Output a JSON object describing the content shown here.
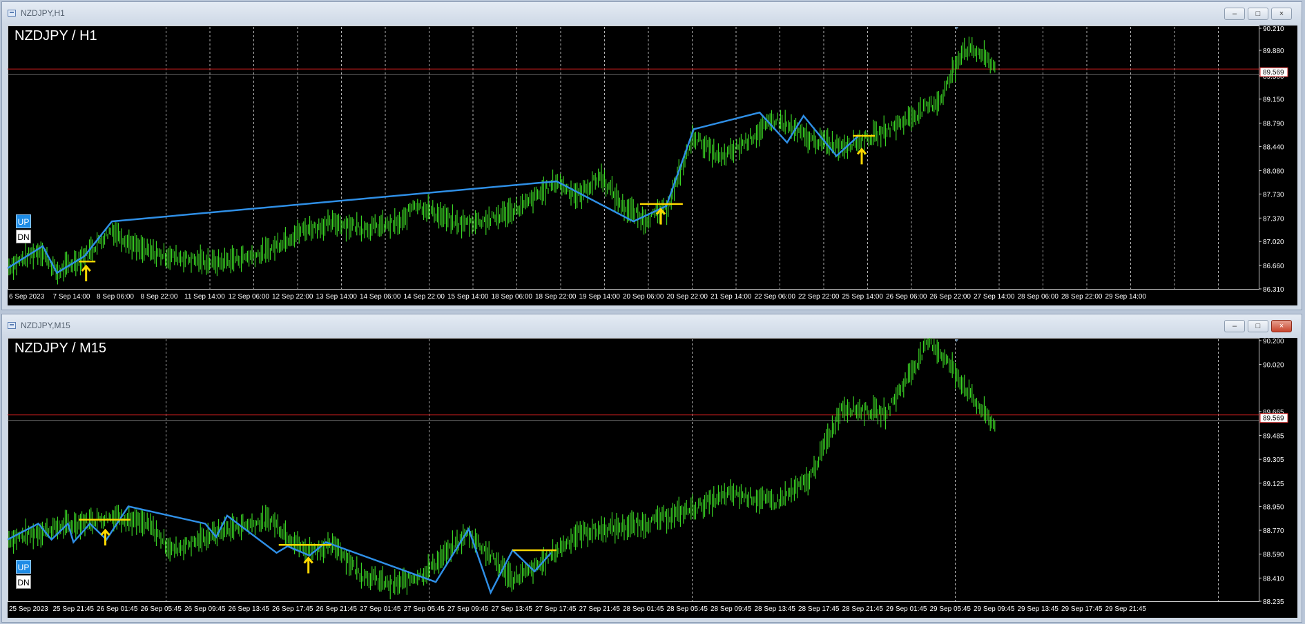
{
  "windows": [
    {
      "title": "NZDJPY,H1",
      "symbol_label": "NZDJPY / H1",
      "up_label": "UP",
      "dn_label": "DN",
      "current_price": "89.569",
      "red_line_price": 89.6,
      "price_ticks": [
        "90.210",
        "89.880",
        "89.500",
        "89.150",
        "88.790",
        "88.440",
        "88.080",
        "87.730",
        "87.370",
        "87.020",
        "86.660",
        "86.310"
      ],
      "time_ticks": [
        "6 Sep 2023",
        "7 Sep 14:00",
        "8 Sep 06:00",
        "8 Sep 22:00",
        "11 Sep 14:00",
        "12 Sep 06:00",
        "12 Sep 22:00",
        "13 Sep 14:00",
        "14 Sep 06:00",
        "14 Sep 22:00",
        "15 Sep 14:00",
        "18 Sep 06:00",
        "18 Sep 22:00",
        "19 Sep 14:00",
        "20 Sep 06:00",
        "20 Sep 22:00",
        "21 Sep 14:00",
        "22 Sep 06:00",
        "22 Sep 22:00",
        "25 Sep 14:00",
        "26 Sep 06:00",
        "26 Sep 22:00",
        "27 Sep 14:00",
        "28 Sep 06:00",
        "28 Sep 22:00",
        "29 Sep 14:00"
      ],
      "price_path": [
        [
          0,
          86.63
        ],
        [
          0.03,
          86.9
        ],
        [
          0.045,
          86.55
        ],
        [
          0.07,
          86.8
        ],
        [
          0.095,
          87.2
        ],
        [
          0.12,
          86.9
        ],
        [
          0.14,
          86.82
        ],
        [
          0.19,
          86.7
        ],
        [
          0.235,
          86.85
        ],
        [
          0.25,
          87.02
        ],
        [
          0.27,
          87.2
        ],
        [
          0.3,
          87.3
        ],
        [
          0.33,
          87.22
        ],
        [
          0.36,
          87.3
        ],
        [
          0.37,
          87.6
        ],
        [
          0.41,
          87.28
        ],
        [
          0.44,
          87.35
        ],
        [
          0.47,
          87.55
        ],
        [
          0.5,
          87.92
        ],
        [
          0.52,
          87.7
        ],
        [
          0.54,
          88.0
        ],
        [
          0.56,
          87.55
        ],
        [
          0.58,
          87.35
        ],
        [
          0.6,
          87.5
        ],
        [
          0.625,
          88.6
        ],
        [
          0.65,
          88.25
        ],
        [
          0.7,
          88.85
        ],
        [
          0.73,
          88.55
        ],
        [
          0.76,
          88.45
        ],
        [
          0.79,
          88.6
        ],
        [
          0.82,
          88.85
        ],
        [
          0.85,
          89.15
        ],
        [
          0.87,
          89.9
        ],
        [
          0.885,
          89.85
        ],
        [
          0.9,
          89.62
        ]
      ],
      "blue_zigzag": [
        [
          0.0,
          86.62
        ],
        [
          0.032,
          86.95
        ],
        [
          0.045,
          86.55
        ],
        [
          0.07,
          86.8
        ],
        [
          0.095,
          87.32
        ],
        [
          0.5,
          87.92
        ],
        [
          0.57,
          87.32
        ],
        [
          0.6,
          87.55
        ],
        [
          0.625,
          88.7
        ],
        [
          0.685,
          88.95
        ],
        [
          0.71,
          88.5
        ],
        [
          0.725,
          88.9
        ],
        [
          0.755,
          88.3
        ],
        [
          0.775,
          88.6
        ]
      ],
      "yellow_levels": [
        [
          0.065,
          0.08,
          86.72
        ],
        [
          0.576,
          0.615,
          87.58
        ],
        [
          0.77,
          0.79,
          88.6
        ]
      ],
      "arrows": [
        [
          0.0715,
          86.65
        ],
        [
          0.595,
          87.5
        ],
        [
          0.778,
          88.4
        ]
      ],
      "symbol": "NZDJPY"
    },
    {
      "title": "NZDJPY,M15",
      "symbol_label": "NZDJPY / M15",
      "up_label": "UP",
      "dn_label": "DN",
      "current_price": "89.569",
      "red_line_price": 89.64,
      "price_ticks": [
        "90.200",
        "90.020",
        "89.665",
        "89.485",
        "89.305",
        "89.125",
        "88.950",
        "88.770",
        "88.590",
        "88.410",
        "88.235"
      ],
      "time_ticks": [
        "25 Sep 2023",
        "25 Sep 21:45",
        "26 Sep 01:45",
        "26 Sep 05:45",
        "26 Sep 09:45",
        "26 Sep 13:45",
        "26 Sep 17:45",
        "26 Sep 21:45",
        "27 Sep 01:45",
        "27 Sep 05:45",
        "27 Sep 09:45",
        "27 Sep 13:45",
        "27 Sep 17:45",
        "27 Sep 21:45",
        "28 Sep 01:45",
        "28 Sep 05:45",
        "28 Sep 09:45",
        "28 Sep 13:45",
        "28 Sep 17:45",
        "28 Sep 21:45",
        "29 Sep 01:45",
        "29 Sep 05:45",
        "29 Sep 09:45",
        "29 Sep 13:45",
        "29 Sep 17:45",
        "29 Sep 21:45"
      ],
      "price_path": [
        [
          0,
          88.7
        ],
        [
          0.05,
          88.8
        ],
        [
          0.1,
          88.88
        ],
        [
          0.13,
          88.8
        ],
        [
          0.15,
          88.62
        ],
        [
          0.2,
          88.78
        ],
        [
          0.24,
          88.85
        ],
        [
          0.27,
          88.62
        ],
        [
          0.3,
          88.65
        ],
        [
          0.32,
          88.45
        ],
        [
          0.35,
          88.35
        ],
        [
          0.38,
          88.45
        ],
        [
          0.42,
          88.75
        ],
        [
          0.46,
          88.4
        ],
        [
          0.48,
          88.48
        ],
        [
          0.52,
          88.75
        ],
        [
          0.58,
          88.82
        ],
        [
          0.62,
          88.92
        ],
        [
          0.66,
          89.05
        ],
        [
          0.7,
          88.98
        ],
        [
          0.73,
          89.15
        ],
        [
          0.76,
          89.7
        ],
        [
          0.8,
          89.65
        ],
        [
          0.84,
          90.2
        ],
        [
          0.86,
          90.0
        ],
        [
          0.88,
          89.75
        ],
        [
          0.9,
          89.55
        ]
      ],
      "blue_zigzag": [
        [
          0.0,
          88.7
        ],
        [
          0.028,
          88.82
        ],
        [
          0.04,
          88.7
        ],
        [
          0.055,
          88.82
        ],
        [
          0.06,
          88.68
        ],
        [
          0.075,
          88.82
        ],
        [
          0.09,
          88.7
        ],
        [
          0.11,
          88.95
        ],
        [
          0.18,
          88.82
        ],
        [
          0.19,
          88.72
        ],
        [
          0.2,
          88.88
        ],
        [
          0.245,
          88.6
        ],
        [
          0.255,
          88.65
        ],
        [
          0.275,
          88.58
        ],
        [
          0.29,
          88.68
        ],
        [
          0.39,
          88.38
        ],
        [
          0.42,
          88.78
        ],
        [
          0.44,
          88.3
        ],
        [
          0.46,
          88.62
        ],
        [
          0.48,
          88.46
        ],
        [
          0.495,
          88.6
        ]
      ],
      "yellow_levels": [
        [
          0.065,
          0.112,
          88.85
        ],
        [
          0.247,
          0.295,
          88.66
        ],
        [
          0.46,
          0.5,
          88.62
        ]
      ],
      "arrows": [
        [
          0.089,
          88.77
        ],
        [
          0.274,
          88.56
        ]
      ],
      "symbol": "NZDJPY"
    }
  ],
  "colors": {
    "background": "#000000",
    "candles": "#3ee026",
    "zigzag": "#2f8fe6",
    "levels": "#ffd800",
    "price_line": "#c81e1e",
    "grid": "#d0d0d0",
    "axis_text": "#ffffff"
  }
}
